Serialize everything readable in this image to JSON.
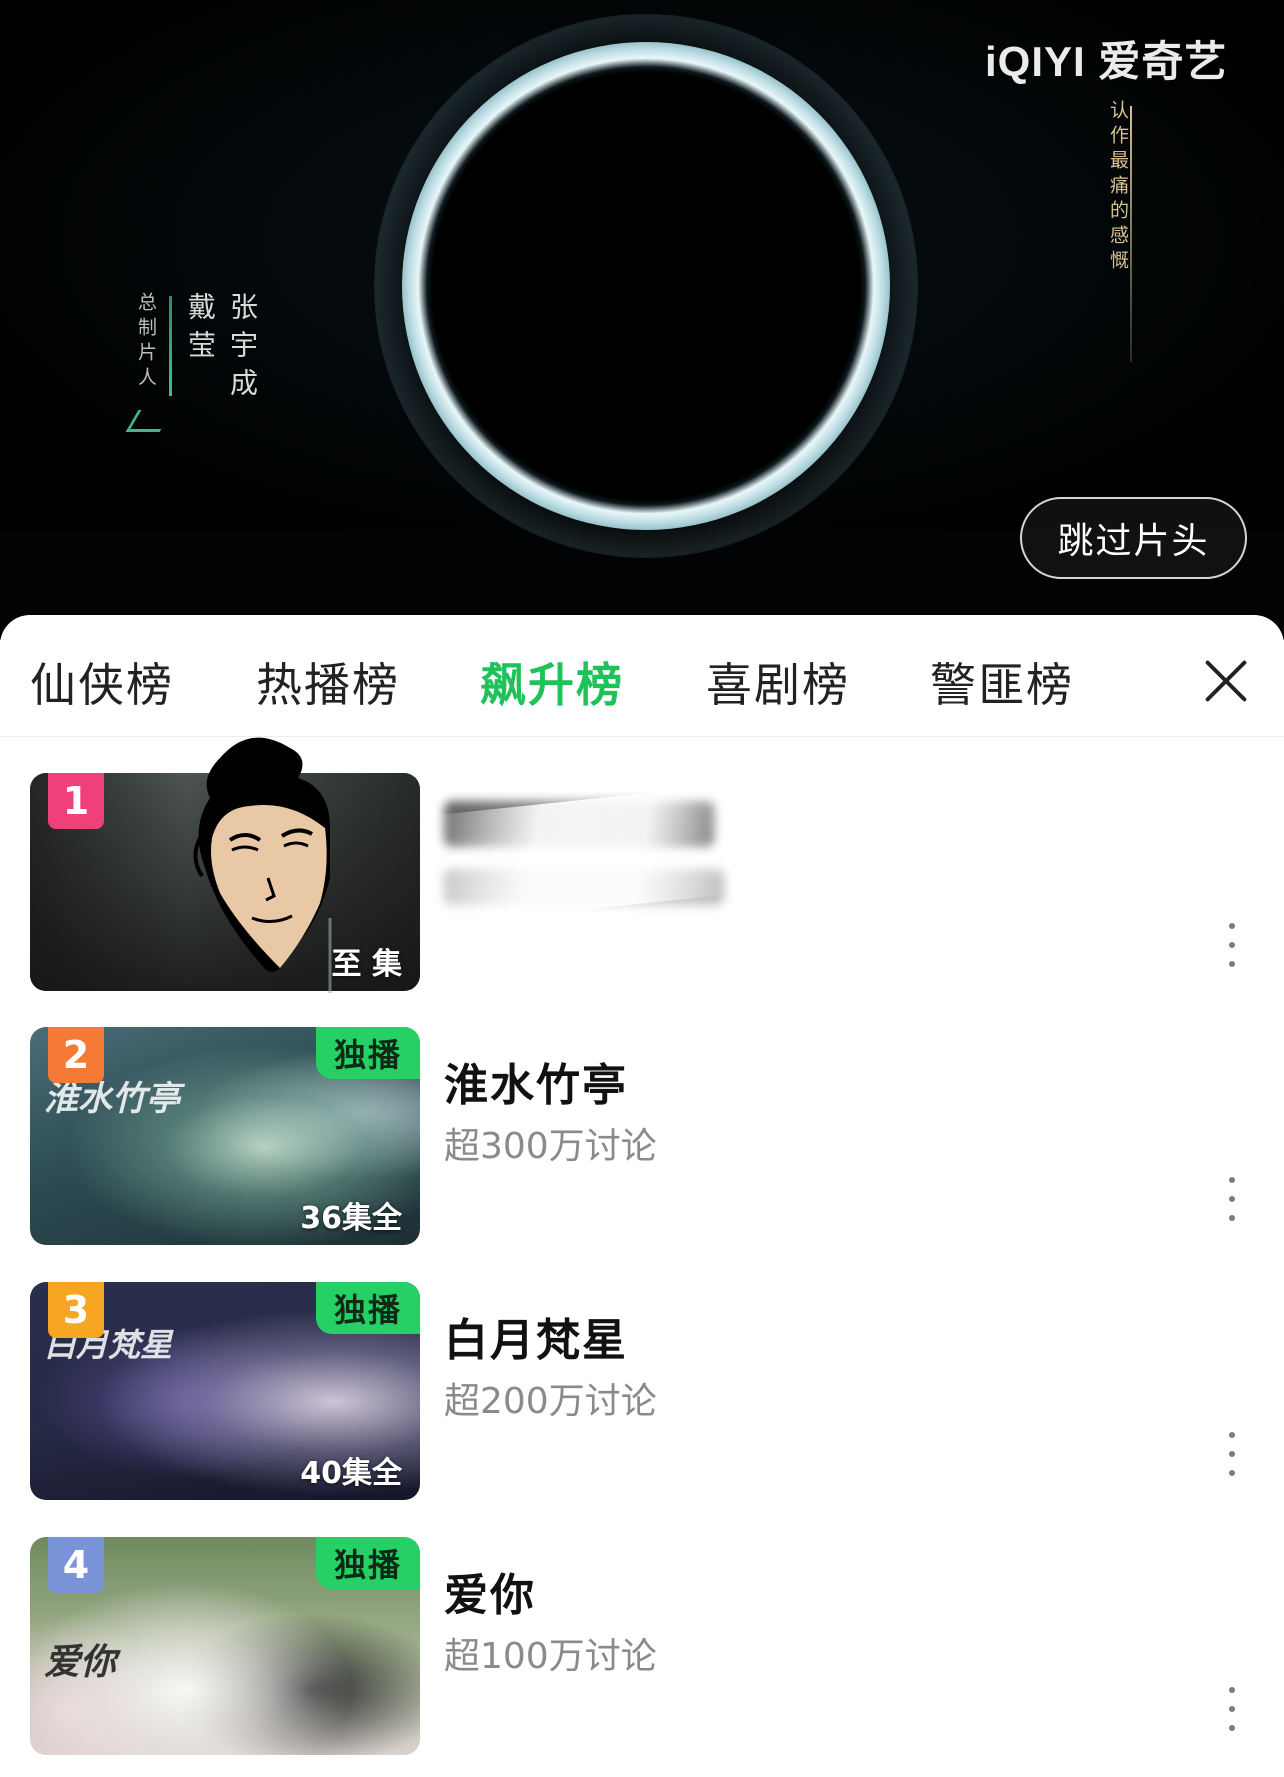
{
  "player": {
    "logo_text": "iQIYI 爱奇艺",
    "credit_left": {
      "role": "总制片人",
      "names": [
        "张宇成",
        "戴莹"
      ]
    },
    "credit_right": "认作最痛的感慨",
    "skip_label": "跳过片头"
  },
  "tabs": {
    "items": [
      {
        "label": "仙侠榜",
        "active": false
      },
      {
        "label": "热播榜",
        "active": false
      },
      {
        "label": "飙升榜",
        "active": true
      },
      {
        "label": "喜剧榜",
        "active": false
      },
      {
        "label": "警匪榜",
        "active": false
      }
    ],
    "active_color": "#1fc159"
  },
  "list": {
    "items": [
      {
        "rank": "1",
        "title": "",
        "subtitle": "",
        "exclusive": "",
        "episodes": "至 集",
        "badge_color": "#f0407a"
      },
      {
        "rank": "2",
        "title": "淮水竹亭",
        "subtitle": "超300万讨论",
        "exclusive": "独播",
        "episodes": "36集全",
        "badge_color": "#f57a35",
        "poster_text": "淮水竹亭"
      },
      {
        "rank": "3",
        "title": "白月梵星",
        "subtitle": "超200万讨论",
        "exclusive": "独播",
        "episodes": "40集全",
        "badge_color": "#f6a623",
        "poster_text": "白月梵星"
      },
      {
        "rank": "4",
        "title": "爱你",
        "subtitle": "超100万讨论",
        "exclusive": "独播",
        "episodes": "",
        "badge_color": "#7a94d8",
        "poster_text": "爱你"
      }
    ],
    "exclusive_color": "#26d066"
  }
}
